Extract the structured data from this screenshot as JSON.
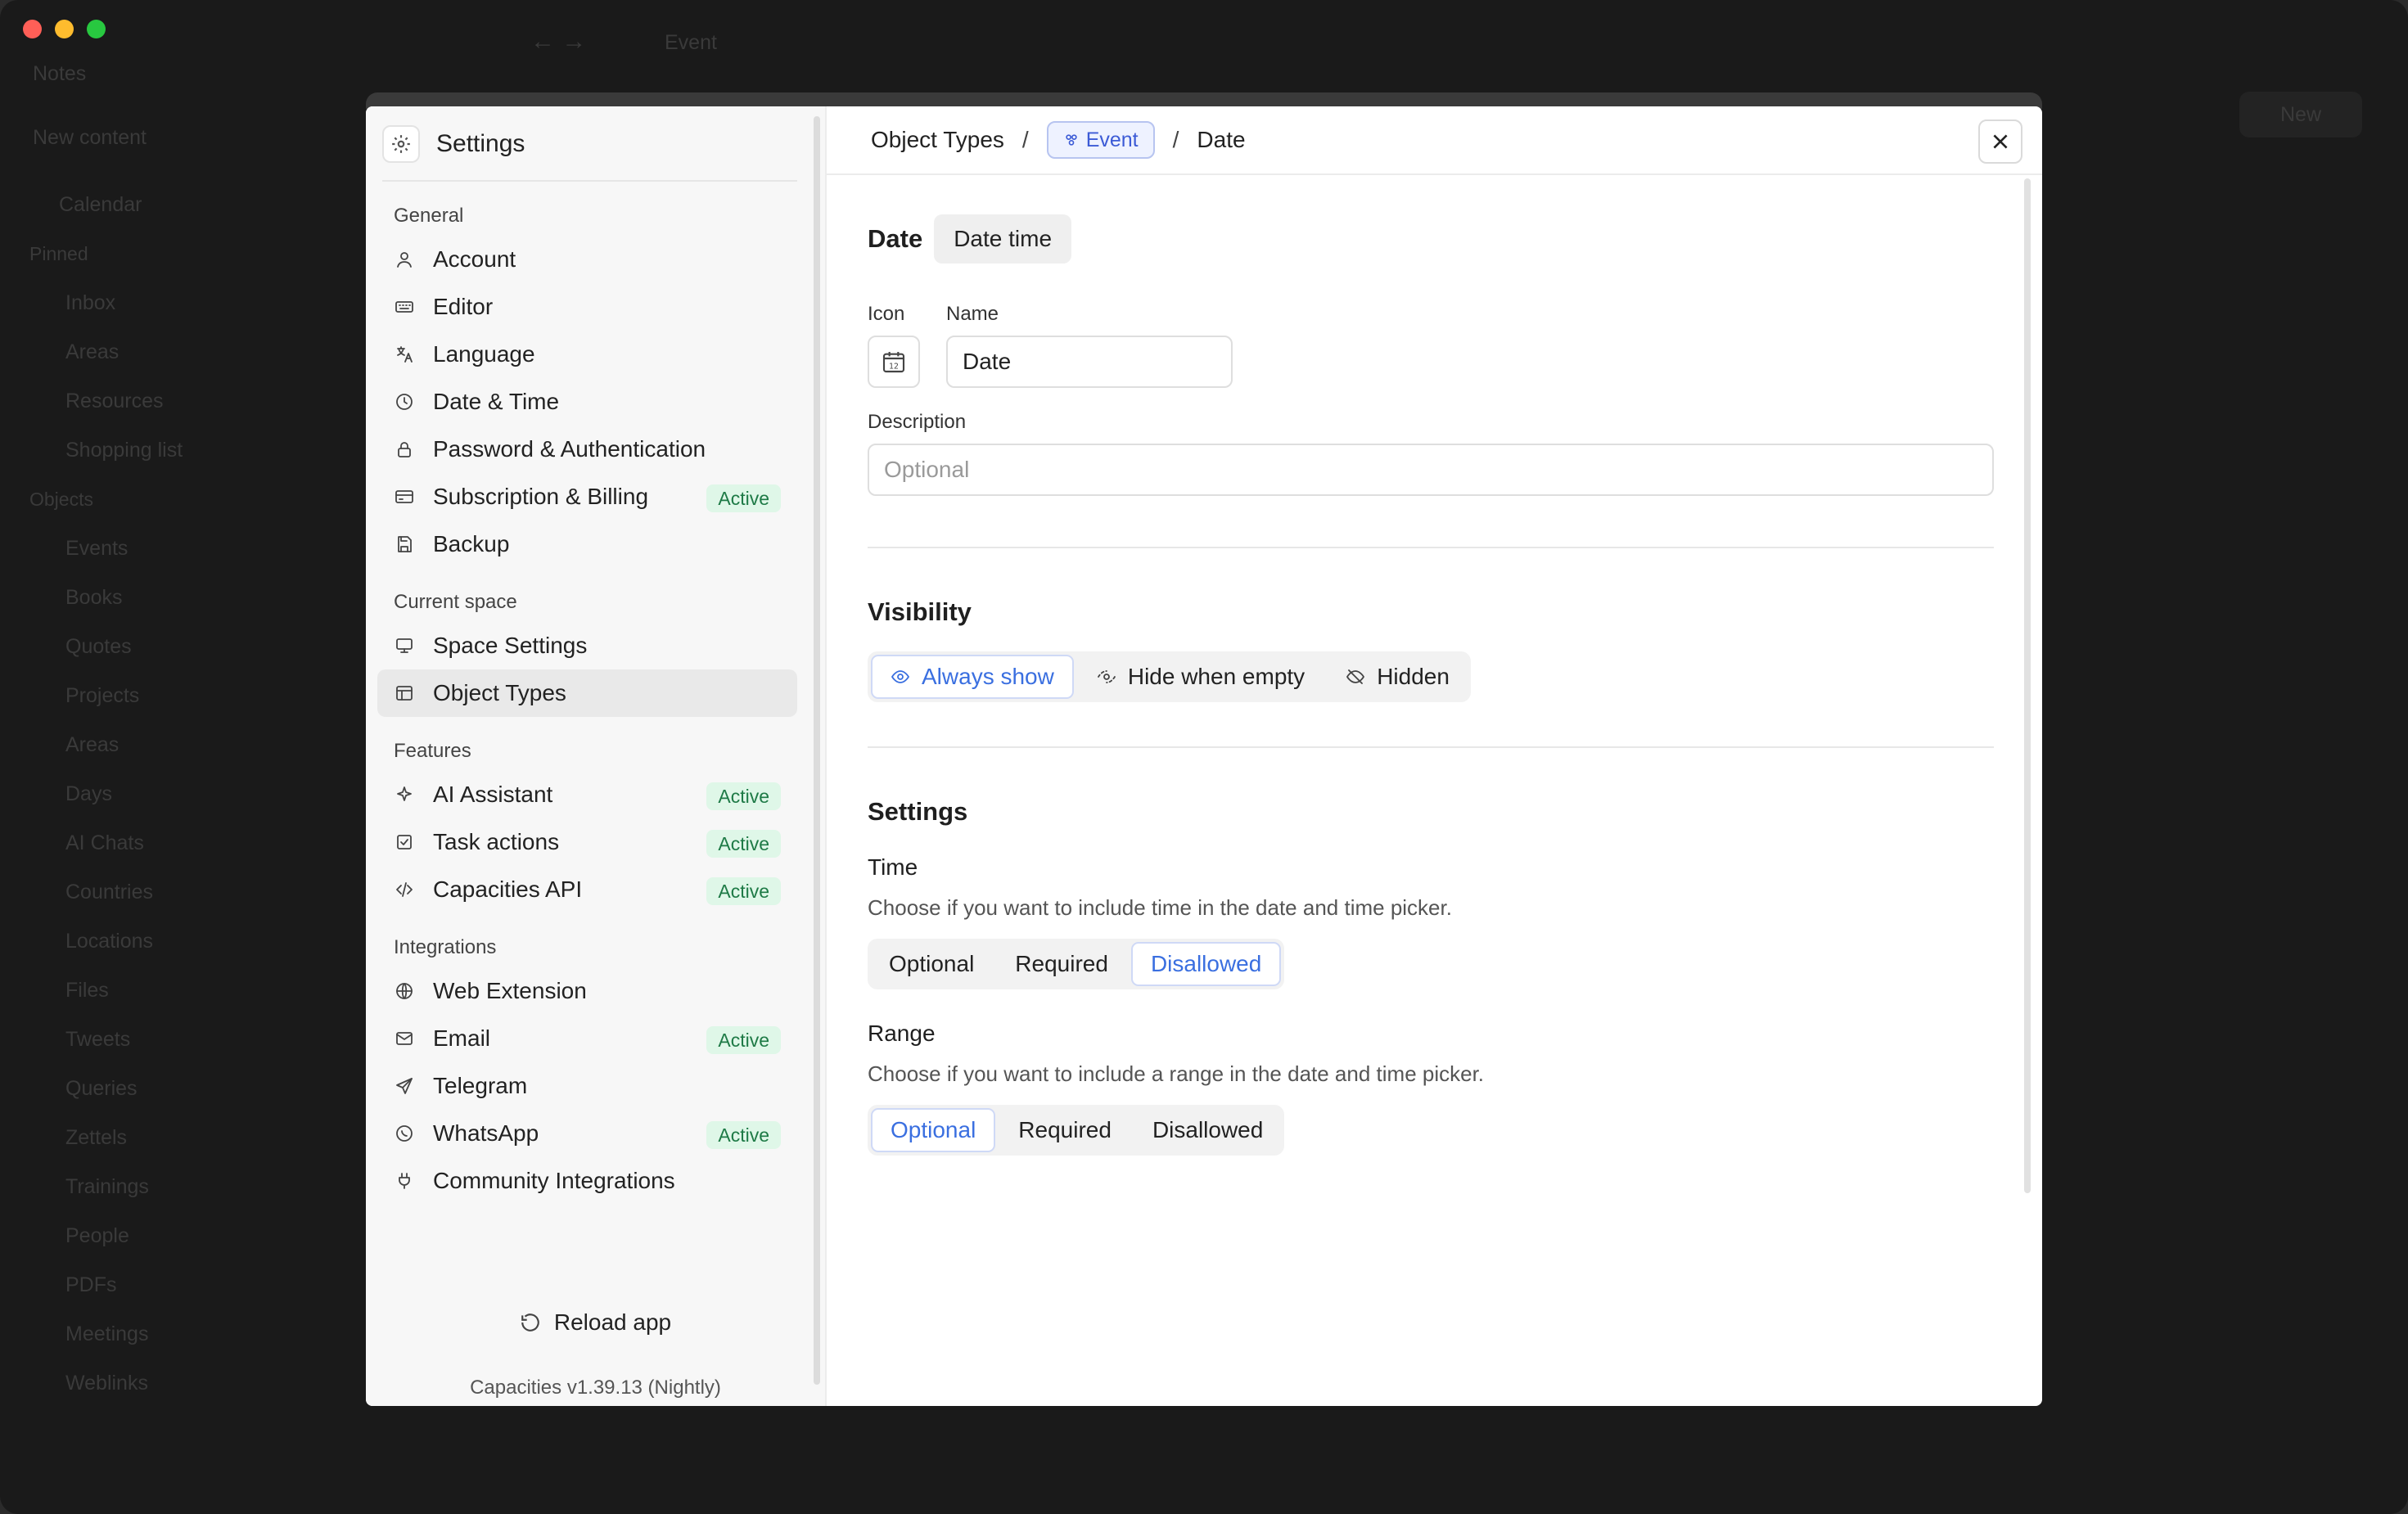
{
  "background": {
    "topbar_title": "Event",
    "space_name": "Notes",
    "new_content": "New content",
    "new_button": "New",
    "sidebar": [
      {
        "label": "Calendar",
        "kind": "item"
      },
      {
        "label": "Pinned",
        "kind": "section"
      },
      {
        "label": "Inbox",
        "kind": "ind"
      },
      {
        "label": "Areas",
        "kind": "ind"
      },
      {
        "label": "Resources",
        "kind": "ind"
      },
      {
        "label": "Shopping list",
        "kind": "ind"
      },
      {
        "label": "Objects",
        "kind": "section"
      },
      {
        "label": "Events",
        "kind": "ind"
      },
      {
        "label": "Books",
        "kind": "ind"
      },
      {
        "label": "Quotes",
        "kind": "ind"
      },
      {
        "label": "Projects",
        "kind": "ind"
      },
      {
        "label": "Areas",
        "kind": "ind"
      },
      {
        "label": "Days",
        "kind": "ind"
      },
      {
        "label": "AI Chats",
        "kind": "ind"
      },
      {
        "label": "Countries",
        "kind": "ind"
      },
      {
        "label": "Locations",
        "kind": "ind"
      },
      {
        "label": "Files",
        "kind": "ind"
      },
      {
        "label": "Tweets",
        "kind": "ind"
      },
      {
        "label": "Queries",
        "kind": "ind"
      },
      {
        "label": "Zettels",
        "kind": "ind"
      },
      {
        "label": "Trainings",
        "kind": "ind"
      },
      {
        "label": "People",
        "kind": "ind"
      },
      {
        "label": "PDFs",
        "kind": "ind"
      },
      {
        "label": "Meetings",
        "kind": "ind"
      },
      {
        "label": "Weblinks",
        "kind": "ind"
      }
    ]
  },
  "settings": {
    "title": "Settings",
    "sections": [
      {
        "label": "General",
        "items": [
          {
            "label": "Account",
            "icon": "user-icon",
            "badge": ""
          },
          {
            "label": "Editor",
            "icon": "keyboard-icon",
            "badge": ""
          },
          {
            "label": "Language",
            "icon": "translate-icon",
            "badge": ""
          },
          {
            "label": "Date & Time",
            "icon": "clock-icon",
            "badge": ""
          },
          {
            "label": "Password & Authentication",
            "icon": "lock-icon",
            "badge": ""
          },
          {
            "label": "Subscription & Billing",
            "icon": "credit-card-icon",
            "badge": "Active"
          },
          {
            "label": "Backup",
            "icon": "save-icon",
            "badge": ""
          }
        ]
      },
      {
        "label": "Current space",
        "items": [
          {
            "label": "Space Settings",
            "icon": "monitor-icon",
            "badge": ""
          },
          {
            "label": "Object Types",
            "icon": "table-icon",
            "badge": "",
            "selected": true
          }
        ]
      },
      {
        "label": "Features",
        "items": [
          {
            "label": "AI Assistant",
            "icon": "sparkle-icon",
            "badge": "Active"
          },
          {
            "label": "Task actions",
            "icon": "checkbox-icon",
            "badge": "Active"
          },
          {
            "label": "Capacities API",
            "icon": "code-icon",
            "badge": "Active"
          }
        ]
      },
      {
        "label": "Integrations",
        "items": [
          {
            "label": "Web Extension",
            "icon": "globe-icon",
            "badge": ""
          },
          {
            "label": "Email",
            "icon": "mail-icon",
            "badge": "Active"
          },
          {
            "label": "Telegram",
            "icon": "send-icon",
            "badge": ""
          },
          {
            "label": "WhatsApp",
            "icon": "whatsapp-icon",
            "badge": "Active"
          },
          {
            "label": "Community Integrations",
            "icon": "plug-icon",
            "badge": ""
          }
        ]
      }
    ],
    "reload_label": "Reload app",
    "version": "Capacities v1.39.13 (Nightly)"
  },
  "detail": {
    "breadcrumb": {
      "root": "Object Types",
      "sep": "/",
      "type_chip": "Event",
      "current": "Date"
    },
    "heading": "Date",
    "type_chip": "Date time",
    "icon_label": "Icon",
    "name_label": "Name",
    "name_value": "Date",
    "description_label": "Description",
    "description_placeholder": "Optional",
    "visibility": {
      "title": "Visibility",
      "options": [
        {
          "label": "Always show",
          "icon": "eye-icon",
          "active": true
        },
        {
          "label": "Hide when empty",
          "icon": "eye-dashed-icon",
          "active": false
        },
        {
          "label": "Hidden",
          "icon": "eye-off-icon",
          "active": false
        }
      ]
    },
    "settings_title": "Settings",
    "time": {
      "title": "Time",
      "description": "Choose if you want to include time in the date and time picker.",
      "options": [
        "Optional",
        "Required",
        "Disallowed"
      ],
      "selected": "Disallowed"
    },
    "range": {
      "title": "Range",
      "description": "Choose if you want to include a range in the date and time picker.",
      "options": [
        "Optional",
        "Required",
        "Disallowed"
      ],
      "selected": "Optional"
    }
  },
  "colors": {
    "accent": "#3a6fe0",
    "badge_bg": "#dff7e8",
    "badge_text": "#1e7a46",
    "chip_border": "#b7c4f0"
  }
}
